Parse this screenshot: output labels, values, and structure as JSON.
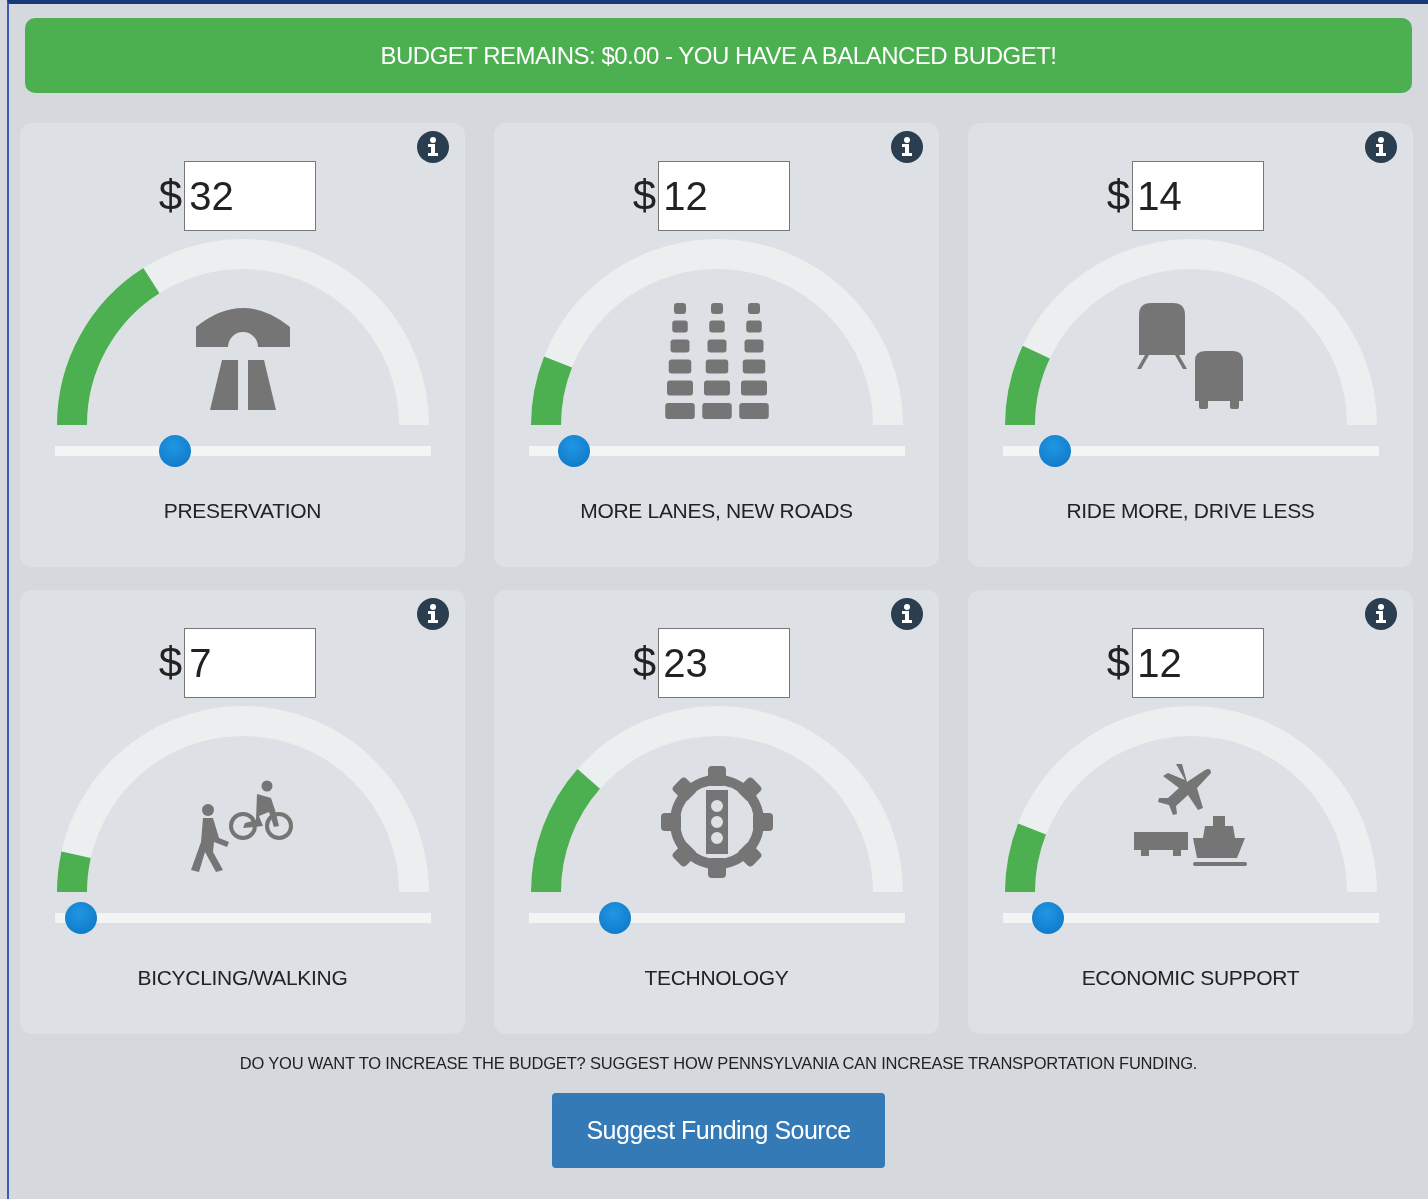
{
  "banner": {
    "text": "BUDGET REMAINS: $0.00 - YOU HAVE A BALANCED BUDGET!"
  },
  "categories": [
    {
      "kind": "bridge",
      "currency": "$",
      "value": "32",
      "level": 0.32,
      "label": "PRESERVATION"
    },
    {
      "kind": "lanes",
      "currency": "$",
      "value": "12",
      "level": 0.12,
      "label": "MORE LANES, NEW ROADS"
    },
    {
      "kind": "transit",
      "currency": "$",
      "value": "14",
      "level": 0.14,
      "label": "RIDE MORE, DRIVE LESS"
    },
    {
      "kind": "active",
      "currency": "$",
      "value": "7",
      "level": 0.07,
      "label": "BICYCLING/WALKING"
    },
    {
      "kind": "technology",
      "currency": "$",
      "value": "23",
      "level": 0.23,
      "label": "TECHNOLOGY"
    },
    {
      "kind": "freight",
      "currency": "$",
      "value": "12",
      "level": 0.12,
      "label": "ECONOMIC SUPPORT"
    }
  ],
  "prompt": "DO YOU WANT TO INCREASE THE BUDGET? SUGGEST HOW PENNSYLVANIA CAN INCREASE TRANSPORTATION FUNDING.",
  "button": "Suggest Funding Source"
}
